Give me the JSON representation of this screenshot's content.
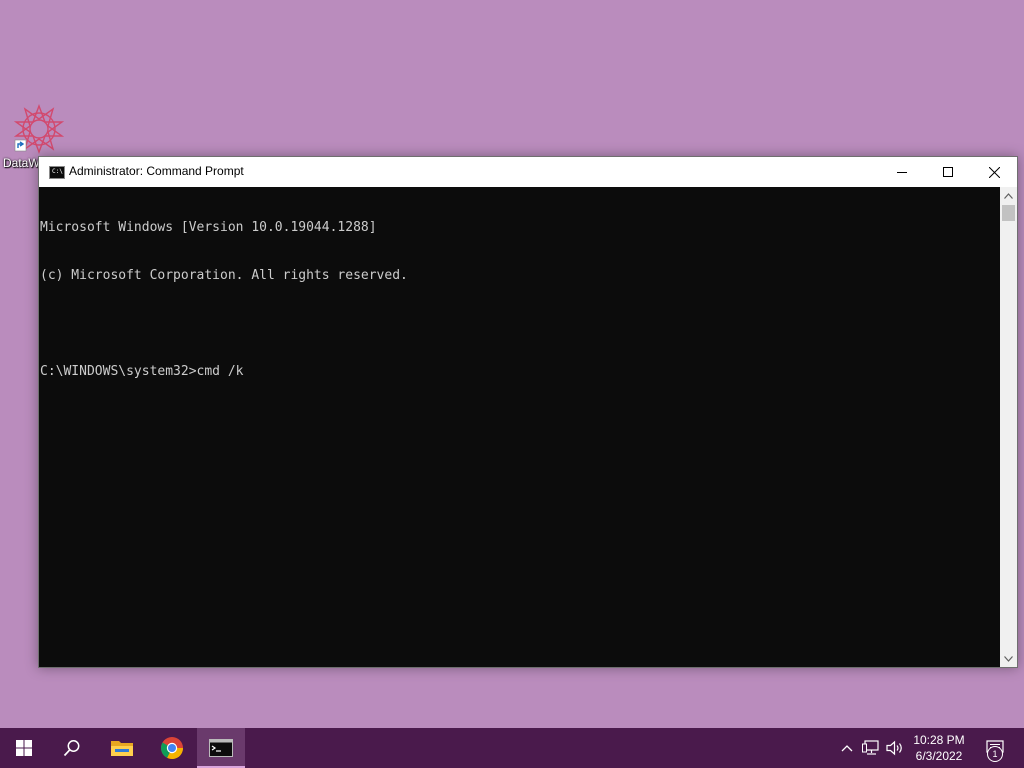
{
  "desktop": {
    "background_color": "#ba8cbd",
    "icons": [
      {
        "label": "DataW",
        "icon": "datawatch-shortcut-icon"
      }
    ]
  },
  "window": {
    "title": "Administrator: Command Prompt",
    "controls": {
      "minimize": "minimize-icon",
      "maximize": "maximize-icon",
      "close": "close-icon"
    },
    "console": {
      "lines": [
        "Microsoft Windows [Version 10.0.19044.1288]",
        "(c) Microsoft Corporation. All rights reserved.",
        "",
        "C:\\WINDOWS\\system32>cmd /k"
      ],
      "background_color": "#0c0c0c",
      "text_color": "#cccccc"
    }
  },
  "taskbar": {
    "background_color": "#4a1a4c",
    "pinned": [
      {
        "name": "start",
        "icon": "windows-start-icon"
      },
      {
        "name": "search",
        "icon": "search-icon"
      },
      {
        "name": "file-explorer",
        "icon": "folder-icon"
      },
      {
        "name": "chrome",
        "icon": "chrome-icon"
      },
      {
        "name": "command-prompt",
        "icon": "cmd-icon",
        "active": true
      }
    ],
    "tray": {
      "icons": [
        "chevron-up-icon",
        "network-icon",
        "volume-icon"
      ],
      "time": "10:28 PM",
      "date": "6/3/2022",
      "notification_count": "1"
    }
  }
}
